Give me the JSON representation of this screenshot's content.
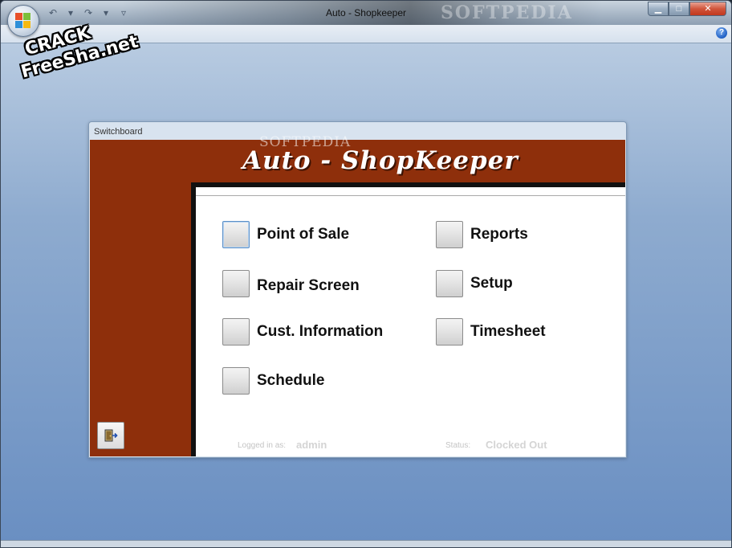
{
  "window": {
    "title": "Auto - Shopkeeper",
    "watermark": "SOFTPEDIA",
    "qat": {
      "undo": "↶",
      "undo_drop": "▾",
      "redo": "↷",
      "redo_drop": "▾",
      "customize": "▿"
    },
    "controls": {
      "minimize": "▁",
      "maximize": "□",
      "close": "✕"
    },
    "help": "?"
  },
  "overlay": {
    "line1": "CRACK",
    "line2": "FreeSha.net"
  },
  "form": {
    "title": "Switchboard",
    "watermark": "SOFTPEDIA",
    "header": "Auto - ShopKeeper",
    "buttons": {
      "point_of_sale": "Point of Sale",
      "repair_screen": "Repair Screen",
      "cust_information": "Cust. Information",
      "schedule": "Schedule",
      "reports": "Reports",
      "setup": "Setup",
      "timesheet": "Timesheet"
    },
    "status": {
      "logged_in_label": "Logged in as:",
      "logged_in_value": "admin",
      "status_label": "Status:",
      "status_value": "Clocked Out"
    }
  },
  "colors": {
    "header_bg": "#8e2f0b",
    "panel_bg": "#ffffff",
    "workspace": "#6a8fc2"
  },
  "icons": {
    "office_button": "office-logo-icon",
    "help": "help-icon",
    "exit": "exit-door-icon"
  }
}
